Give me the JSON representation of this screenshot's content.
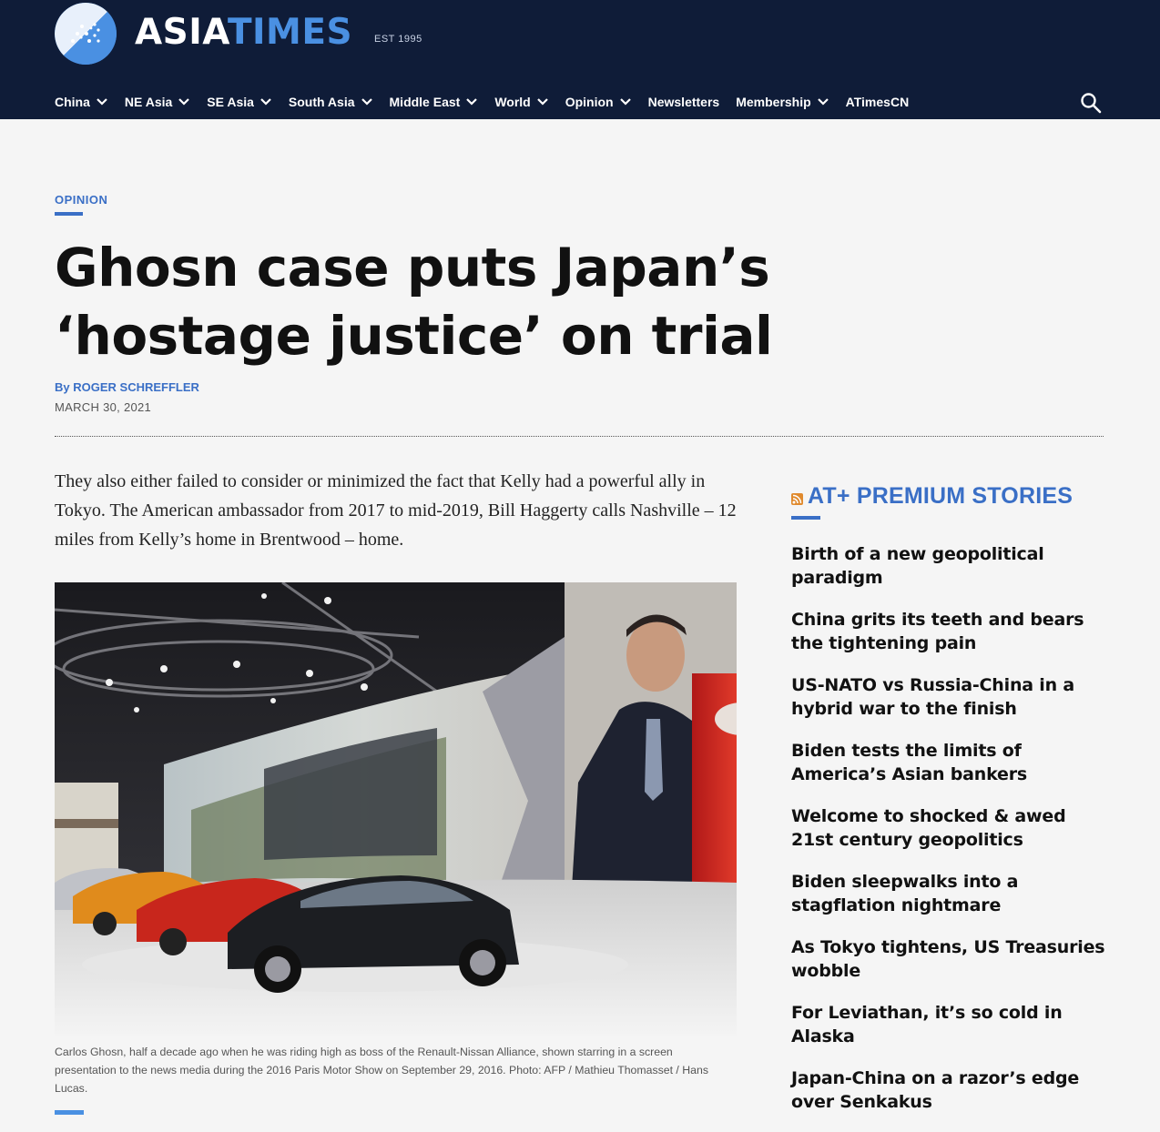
{
  "header": {
    "logo_asia": "ASIA",
    "logo_times": "TIMES",
    "logo_est": "EST 1995"
  },
  "nav": {
    "items": [
      {
        "label": "China",
        "dropdown": true
      },
      {
        "label": "NE Asia",
        "dropdown": true
      },
      {
        "label": "SE Asia",
        "dropdown": true
      },
      {
        "label": "South Asia",
        "dropdown": true
      },
      {
        "label": "Middle East",
        "dropdown": true
      },
      {
        "label": "World",
        "dropdown": true
      },
      {
        "label": "Opinion",
        "dropdown": true
      },
      {
        "label": "Newsletters",
        "dropdown": false
      },
      {
        "label": "Membership",
        "dropdown": true
      },
      {
        "label": "ATimesCN",
        "dropdown": false
      }
    ],
    "search_icon": "search-icon"
  },
  "article": {
    "kicker": "OPINION",
    "headline": "Ghosn case puts Japan’s ‘hostage justice’ on trial",
    "by": "By",
    "author": "ROGER SCHREFFLER",
    "date": "MARCH 30, 2021",
    "paragraph": "They also either failed to consider or minimized the fact that Kelly had a powerful ally in Tokyo. The American ambassador from 2017 to mid-2019, Bill Haggerty calls Nashville – 12 miles from Kelly’s home in Brentwood – home.",
    "caption": "Carlos Ghosn, half a decade ago when he was riding high as boss of the Renault-Nissan Alliance, shown starring in a screen presentation to the news media during the 2016 Paris Motor Show on September 29, 2016. Photo: AFP / Mathieu Thomasset / Hans Lucas."
  },
  "sidebar": {
    "title": "AT+ PREMIUM STORIES",
    "icon": "rss-icon",
    "stories": [
      "Birth of a new geopolitical paradigm",
      "China grits its teeth and bears the tightening pain",
      "US-NATO vs Russia-China in a hybrid war to the finish",
      "Biden tests the limits of America’s Asian bankers",
      "Welcome to shocked & awed 21st century geopolitics",
      "Biden sleepwalks into a stagflation nightmare",
      "As Tokyo tightens, US Treasuries wobble",
      "For Leviathan, it’s so cold in Alaska",
      "Japan-China on a razor’s edge over Senkakus"
    ]
  },
  "colors": {
    "header_bg": "#0f1c38",
    "accent": "#3a6fc6",
    "logo_blue": "#4a90e2"
  }
}
